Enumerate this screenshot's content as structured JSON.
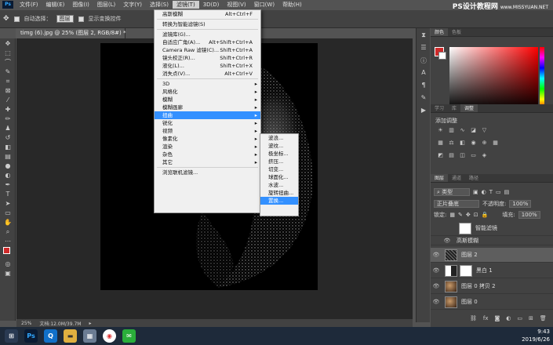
{
  "menubar": {
    "app_icon": "Ps",
    "items": [
      "文件(F)",
      "编辑(E)",
      "图像(I)",
      "图层(L)",
      "文字(Y)",
      "选择(S)",
      "滤镜(T)",
      "3D(D)",
      "视图(V)",
      "窗口(W)",
      "帮助(H)"
    ],
    "active_index": 6
  },
  "watermark": {
    "title": "PS设计教程网",
    "url": "www.MISSYUAN.NET"
  },
  "options": {
    "auto_select_label": "自动选择：",
    "auto_select_value": "图层",
    "transform_label": "显示变换控件"
  },
  "document": {
    "tab_title": "timg (6).jpg @ 25% (图层 2, RGB/8#) *",
    "zoom": "25%",
    "doc_size": "文档:12.0M/39.7M"
  },
  "filter_menu": {
    "top": [
      {
        "label": "高斯模糊",
        "shortcut": "Alt+Ctrl+F"
      },
      {
        "label": "转换为智能滤镜(S)",
        "shortcut": ""
      },
      {
        "label": "滤镜库(G)...",
        "shortcut": ""
      },
      {
        "label": "自适应广角(A)...",
        "shortcut": "Alt+Shift+Ctrl+A"
      },
      {
        "label": "Camera Raw 滤镜(C)...",
        "shortcut": "Shift+Ctrl+A"
      },
      {
        "label": "镜头校正(R)...",
        "shortcut": "Shift+Ctrl+R"
      },
      {
        "label": "液化(L)...",
        "shortcut": "Shift+Ctrl+X"
      },
      {
        "label": "消失点(V)...",
        "shortcut": "Alt+Ctrl+V"
      }
    ],
    "groups": [
      "3D",
      "风格化",
      "模糊",
      "模糊画廊",
      "扭曲",
      "锐化",
      "视频",
      "像素化",
      "渲染",
      "杂色",
      "其它"
    ],
    "active_group_index": 4,
    "browse": "浏览联机滤镜..."
  },
  "distort_submenu": {
    "items": [
      "波浪...",
      "波纹...",
      "极坐标...",
      "挤压...",
      "切变...",
      "球面化...",
      "水波...",
      "旋转扭曲...",
      "置换..."
    ],
    "active_index": 8
  },
  "panels": {
    "color_tabs": [
      "颜色",
      "色板"
    ],
    "adjust_tabs": [
      "学习",
      "库",
      "调整"
    ],
    "adjust_title": "添加调整",
    "layer_tabs": [
      "图层",
      "通道",
      "路径"
    ],
    "filter_kind": "类型",
    "blend_mode": "正片叠底",
    "opacity_label": "不透明度:",
    "opacity_value": "100%",
    "lock_label": "锁定:",
    "fill_label": "填充:",
    "fill_value": "100%",
    "layers": [
      {
        "name": "智能滤镜"
      },
      {
        "name": "高斯模糊"
      },
      {
        "name": "图层 2"
      },
      {
        "name": "黑白 1"
      },
      {
        "name": "图层 0 拷贝 2"
      },
      {
        "name": "图层 0"
      }
    ]
  },
  "colors": {
    "foreground": "#cf2a2a",
    "selection": "#3390ff"
  },
  "tray": {
    "time": "9:43",
    "date": "2019/6/26"
  }
}
